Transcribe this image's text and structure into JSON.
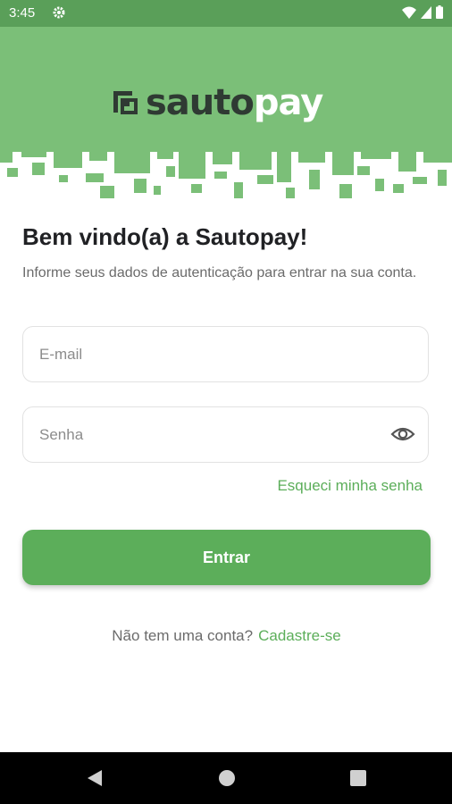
{
  "status_bar": {
    "time": "3:45",
    "icons": [
      "gear-icon",
      "wifi-icon",
      "signal-icon",
      "battery-icon"
    ]
  },
  "brand": {
    "name_part1": "sauto",
    "name_part2": "pay",
    "header_color": "#7bbf78",
    "accent": "#5cae5a",
    "dark": "#2f3a33"
  },
  "login": {
    "title": "Bem vindo(a) a Sautopay!",
    "subtitle": "Informe seus dados de autenticação para entrar na sua conta.",
    "email": {
      "value": "",
      "placeholder": "E-mail"
    },
    "password": {
      "value": "",
      "placeholder": "Senha",
      "toggle_icon": "eye-icon"
    },
    "forgot_label": "Esqueci minha senha",
    "submit_label": "Entrar",
    "no_account_text": "Não tem uma conta?",
    "signup_label": "Cadastre-se"
  },
  "nav_bar": {
    "buttons": [
      "back-icon",
      "home-icon",
      "recents-icon"
    ]
  }
}
